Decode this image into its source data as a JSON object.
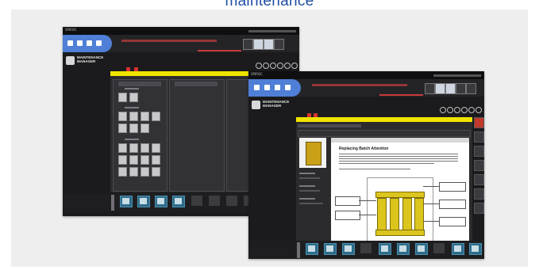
{
  "heading": "maintenance",
  "screenshot_back": {
    "app_brand": "SPIROC",
    "app_title": "MAINTENANCE MANAGER"
  },
  "screenshot_front": {
    "app_brand": "SPIROC",
    "app_title": "MAINTENANCE MANAGER",
    "document_heading": "Replacing Batch Attention"
  },
  "colors": {
    "nav_accent": "#4f7fd6",
    "highlight_bar": "#f1e300",
    "icon_teal": "#2e6c8a",
    "background_panel": "#eeeeee",
    "heading_blue": "#1f4ea3"
  }
}
